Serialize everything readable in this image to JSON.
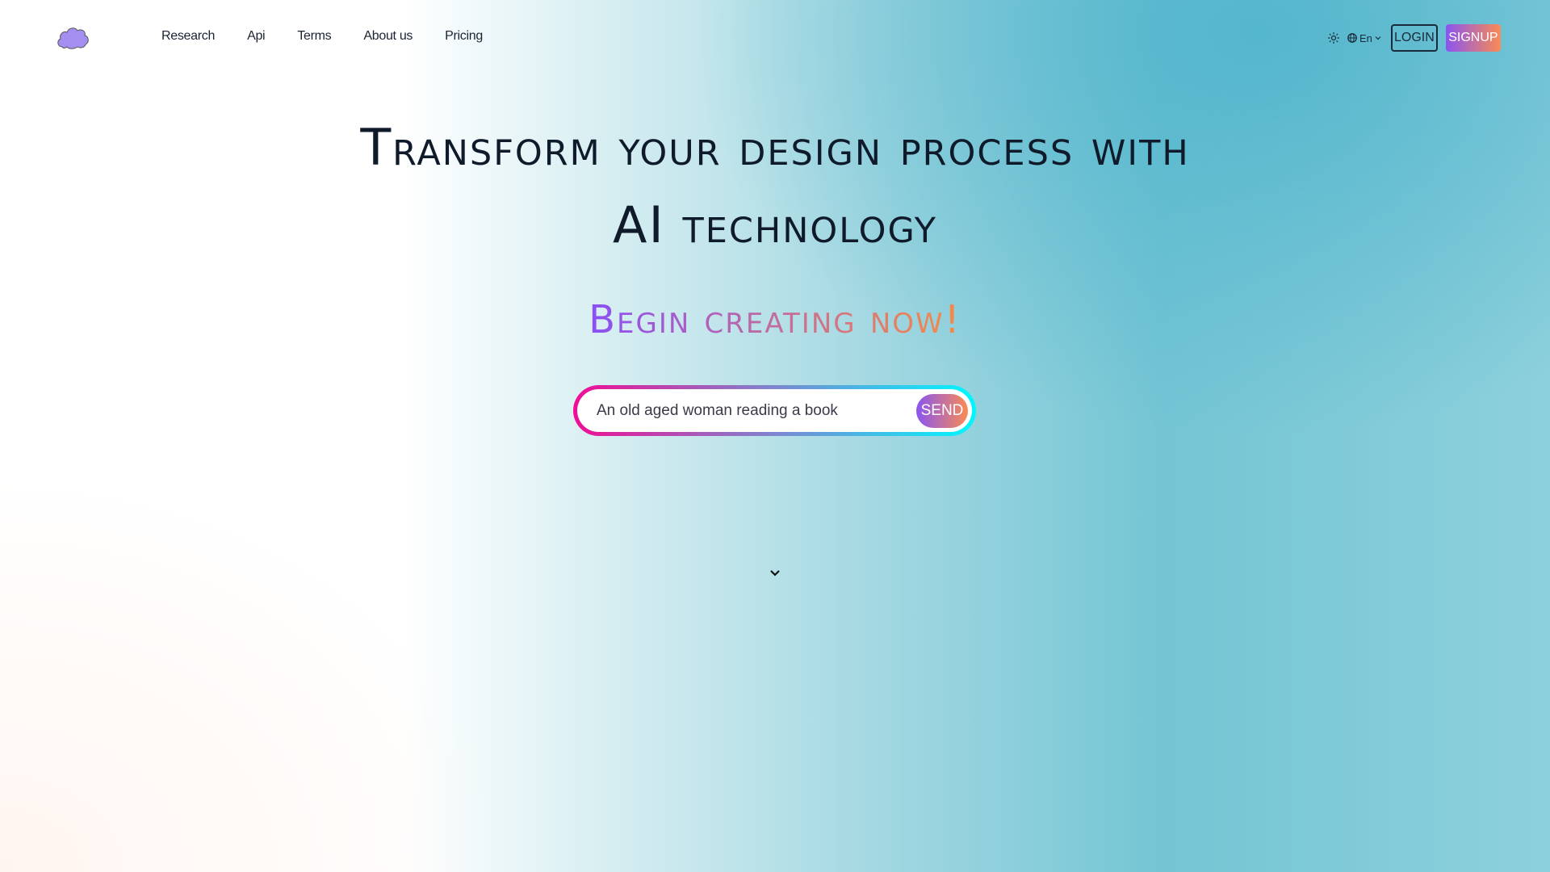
{
  "nav": {
    "links": [
      "Research",
      "Api",
      "Terms",
      "About us",
      "Pricing"
    ],
    "language": "En",
    "login": "LOGIN",
    "signup": "SIGNUP"
  },
  "hero": {
    "title_line1": "Transform your design process with",
    "title_line2": "AI technology",
    "subtitle": "Begin creating now!"
  },
  "prompt": {
    "placeholder": "An old aged woman reading a book",
    "send": "SEND"
  },
  "icons": {
    "logo": "cloud-logo",
    "theme": "sun-icon",
    "language": "globe-icon",
    "scroll": "chevron-down-icon"
  },
  "colors": {
    "gradient_start": "#8a55f0",
    "gradient_end": "#f98b55",
    "border_start": "#f00d95",
    "border_end": "#00f7ff"
  }
}
